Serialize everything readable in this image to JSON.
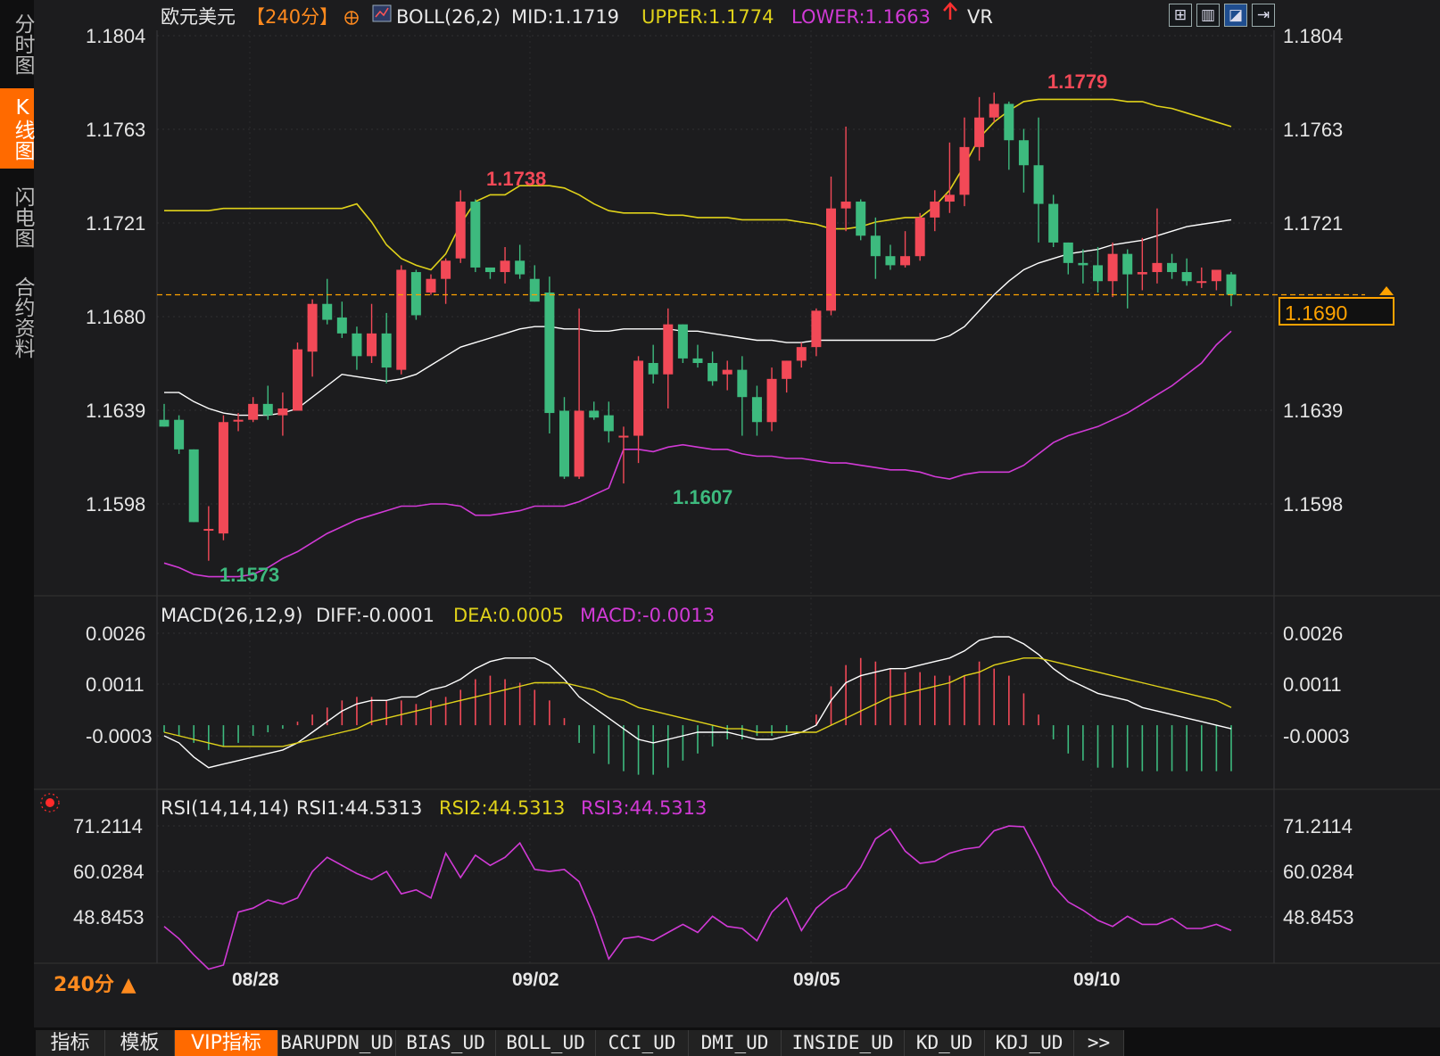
{
  "sidebar": {
    "tabs": [
      {
        "label": "分时图",
        "active": false
      },
      {
        "label": "K线图",
        "active": true
      },
      {
        "label": "闪电图",
        "active": false
      },
      {
        "label": "合约资料",
        "active": false
      }
    ]
  },
  "header": {
    "symbol": "欧元美元",
    "period": "【240分】",
    "boll": "BOLL(26,2)",
    "mid": "MID:1.1719",
    "upper": "UPPER:1.1774",
    "lower": "LOWER:1.1663",
    "extra": "VR"
  },
  "toolbar": {
    "icons": [
      "grid-icon",
      "chart-window-icon",
      "chart-trend-icon",
      "exit-window-icon"
    ]
  },
  "price_axis": {
    "ticks": [
      "1.1804",
      "1.1763",
      "1.1721",
      "1.1680",
      "1.1639",
      "1.1598"
    ]
  },
  "current_price": "1.1690",
  "annotations": {
    "high1": "1.1738",
    "high2": "1.1779",
    "low1": "1.1573",
    "low2": "1.1607"
  },
  "macd": {
    "title": "MACD(26,12,9)",
    "diff": "DIFF:-0.0001",
    "dea": "DEA:0.0005",
    "macd": "MACD:-0.0013",
    "ticks": [
      "0.0026",
      "0.0011",
      "-0.0003"
    ]
  },
  "rsi": {
    "title": "RSI(14,14,14)",
    "rsi1": "RSI1:44.5313",
    "rsi2": "RSI2:44.5313",
    "rsi3": "RSI3:44.5313",
    "ticks": [
      "71.2114",
      "60.0284",
      "48.8453"
    ]
  },
  "x_axis": {
    "labels": [
      "08/28",
      "09/02",
      "09/05",
      "09/10"
    ]
  },
  "period_label": "240分 ▲",
  "bottom_tabs": [
    {
      "label": "指标",
      "type": "cn"
    },
    {
      "label": "模板",
      "type": "cn"
    },
    {
      "label": "VIP指标",
      "type": "vip"
    },
    {
      "label": "BARUPDN_UD",
      "type": "en"
    },
    {
      "label": "BIAS_UD",
      "type": "en"
    },
    {
      "label": "BOLL_UD",
      "type": "en"
    },
    {
      "label": "CCI_UD",
      "type": "en"
    },
    {
      "label": "DMI_UD",
      "type": "en"
    },
    {
      "label": "INSIDE_UD",
      "type": "en"
    },
    {
      "label": "KD_UD",
      "type": "en"
    },
    {
      "label": "KDJ_UD",
      "type": "en"
    },
    {
      "label": ">>",
      "type": "en"
    }
  ],
  "colors": {
    "up": "#f24957",
    "down": "#3dba7e",
    "upper": "#e0d21a",
    "lower": "#d13ad6",
    "mid": "#ffffff",
    "accent": "#ff6a00"
  },
  "chart_data": {
    "type": "candlestick",
    "candles": [
      {
        "o": 1.1635,
        "h": 1.1642,
        "l": 1.1634,
        "c": 1.1632
      },
      {
        "o": 1.1635,
        "h": 1.1637,
        "l": 1.162,
        "c": 1.1622
      },
      {
        "o": 1.1622,
        "h": 1.1622,
        "l": 1.159,
        "c": 1.159
      },
      {
        "o": 1.1587,
        "h": 1.1597,
        "l": 1.1573,
        "c": 1.1587
      },
      {
        "o": 1.1585,
        "h": 1.1637,
        "l": 1.1582,
        "c": 1.1634
      },
      {
        "o": 1.1635,
        "h": 1.1638,
        "l": 1.163,
        "c": 1.1635
      },
      {
        "o": 1.1635,
        "h": 1.1645,
        "l": 1.1634,
        "c": 1.1642
      },
      {
        "o": 1.1642,
        "h": 1.165,
        "l": 1.1635,
        "c": 1.1637
      },
      {
        "o": 1.1637,
        "h": 1.1647,
        "l": 1.1628,
        "c": 1.164
      },
      {
        "o": 1.1639,
        "h": 1.1669,
        "l": 1.1639,
        "c": 1.1666
      },
      {
        "o": 1.1665,
        "h": 1.1688,
        "l": 1.1654,
        "c": 1.1686
      },
      {
        "o": 1.1686,
        "h": 1.1697,
        "l": 1.1677,
        "c": 1.1679
      },
      {
        "o": 1.168,
        "h": 1.1687,
        "l": 1.1671,
        "c": 1.1673
      },
      {
        "o": 1.1673,
        "h": 1.1676,
        "l": 1.1657,
        "c": 1.1663
      },
      {
        "o": 1.1663,
        "h": 1.1686,
        "l": 1.166,
        "c": 1.1673
      },
      {
        "o": 1.1673,
        "h": 1.1682,
        "l": 1.1651,
        "c": 1.1658
      },
      {
        "o": 1.1657,
        "h": 1.1703,
        "l": 1.1655,
        "c": 1.1701
      },
      {
        "o": 1.17,
        "h": 1.1701,
        "l": 1.1679,
        "c": 1.1681
      },
      {
        "o": 1.1691,
        "h": 1.1699,
        "l": 1.169,
        "c": 1.1697
      },
      {
        "o": 1.1697,
        "h": 1.1706,
        "l": 1.1686,
        "c": 1.1705
      },
      {
        "o": 1.1706,
        "h": 1.1736,
        "l": 1.1704,
        "c": 1.1731
      },
      {
        "o": 1.1731,
        "h": 1.1732,
        "l": 1.17,
        "c": 1.1702
      },
      {
        "o": 1.1702,
        "h": 1.17,
        "l": 1.1697,
        "c": 1.17
      },
      {
        "o": 1.17,
        "h": 1.1711,
        "l": 1.1695,
        "c": 1.1705
      },
      {
        "o": 1.1705,
        "h": 1.1712,
        "l": 1.1697,
        "c": 1.1699
      },
      {
        "o": 1.1697,
        "h": 1.1703,
        "l": 1.1688,
        "c": 1.1687
      },
      {
        "o": 1.1691,
        "h": 1.1698,
        "l": 1.1629,
        "c": 1.1638
      },
      {
        "o": 1.1639,
        "h": 1.1645,
        "l": 1.1609,
        "c": 1.161
      },
      {
        "o": 1.161,
        "h": 1.1684,
        "l": 1.1609,
        "c": 1.1639
      },
      {
        "o": 1.1639,
        "h": 1.1643,
        "l": 1.1635,
        "c": 1.1636
      },
      {
        "o": 1.1637,
        "h": 1.1643,
        "l": 1.1625,
        "c": 1.163
      },
      {
        "o": 1.1628,
        "h": 1.1632,
        "l": 1.1607,
        "c": 1.1628
      },
      {
        "o": 1.1628,
        "h": 1.1663,
        "l": 1.1616,
        "c": 1.1661
      },
      {
        "o": 1.166,
        "h": 1.1668,
        "l": 1.1651,
        "c": 1.1655
      },
      {
        "o": 1.1655,
        "h": 1.1684,
        "l": 1.164,
        "c": 1.1677
      },
      {
        "o": 1.1677,
        "h": 1.1676,
        "l": 1.166,
        "c": 1.1662
      },
      {
        "o": 1.1662,
        "h": 1.1668,
        "l": 1.1658,
        "c": 1.166
      },
      {
        "o": 1.166,
        "h": 1.1665,
        "l": 1.165,
        "c": 1.1652
      },
      {
        "o": 1.1655,
        "h": 1.1661,
        "l": 1.1648,
        "c": 1.1657
      },
      {
        "o": 1.1657,
        "h": 1.1663,
        "l": 1.1628,
        "c": 1.1645
      },
      {
        "o": 1.1645,
        "h": 1.165,
        "l": 1.1628,
        "c": 1.1634
      },
      {
        "o": 1.1634,
        "h": 1.1658,
        "l": 1.163,
        "c": 1.1653
      },
      {
        "o": 1.1653,
        "h": 1.1661,
        "l": 1.1647,
        "c": 1.1661
      },
      {
        "o": 1.1661,
        "h": 1.1669,
        "l": 1.1658,
        "c": 1.1667
      },
      {
        "o": 1.1667,
        "h": 1.1684,
        "l": 1.1663,
        "c": 1.1683
      },
      {
        "o": 1.1683,
        "h": 1.1742,
        "l": 1.1681,
        "c": 1.1728
      },
      {
        "o": 1.1728,
        "h": 1.1764,
        "l": 1.1718,
        "c": 1.1731
      },
      {
        "o": 1.1731,
        "h": 1.1732,
        "l": 1.1714,
        "c": 1.1716
      },
      {
        "o": 1.1716,
        "h": 1.1724,
        "l": 1.1697,
        "c": 1.1707
      },
      {
        "o": 1.1707,
        "h": 1.1712,
        "l": 1.1701,
        "c": 1.1703
      },
      {
        "o": 1.1703,
        "h": 1.1718,
        "l": 1.1702,
        "c": 1.1707
      },
      {
        "o": 1.1707,
        "h": 1.1726,
        "l": 1.1705,
        "c": 1.1724
      },
      {
        "o": 1.1724,
        "h": 1.1736,
        "l": 1.1718,
        "c": 1.1731
      },
      {
        "o": 1.1731,
        "h": 1.1757,
        "l": 1.1726,
        "c": 1.1734
      },
      {
        "o": 1.1734,
        "h": 1.1768,
        "l": 1.1729,
        "c": 1.1755
      },
      {
        "o": 1.1755,
        "h": 1.1777,
        "l": 1.1749,
        "c": 1.1768
      },
      {
        "o": 1.1768,
        "h": 1.1779,
        "l": 1.1766,
        "c": 1.1774
      },
      {
        "o": 1.1774,
        "h": 1.1775,
        "l": 1.1745,
        "c": 1.1758
      },
      {
        "o": 1.1758,
        "h": 1.1763,
        "l": 1.1735,
        "c": 1.1747
      },
      {
        "o": 1.1747,
        "h": 1.1768,
        "l": 1.1713,
        "c": 1.173
      },
      {
        "o": 1.173,
        "h": 1.1734,
        "l": 1.1711,
        "c": 1.1713
      },
      {
        "o": 1.1713,
        "h": 1.1712,
        "l": 1.1699,
        "c": 1.1704
      },
      {
        "o": 1.1704,
        "h": 1.171,
        "l": 1.1695,
        "c": 1.1703
      },
      {
        "o": 1.1703,
        "h": 1.1711,
        "l": 1.1691,
        "c": 1.1696
      },
      {
        "o": 1.1696,
        "h": 1.1713,
        "l": 1.1689,
        "c": 1.1708
      },
      {
        "o": 1.1708,
        "h": 1.171,
        "l": 1.1684,
        "c": 1.1699
      },
      {
        "o": 1.1699,
        "h": 1.1715,
        "l": 1.1692,
        "c": 1.17
      },
      {
        "o": 1.17,
        "h": 1.1728,
        "l": 1.1695,
        "c": 1.1704
      },
      {
        "o": 1.1704,
        "h": 1.1708,
        "l": 1.1697,
        "c": 1.17
      },
      {
        "o": 1.17,
        "h": 1.1706,
        "l": 1.1694,
        "c": 1.1696
      },
      {
        "o": 1.1696,
        "h": 1.1702,
        "l": 1.1693,
        "c": 1.1696
      },
      {
        "o": 1.1696,
        "h": 1.17,
        "l": 1.1692,
        "c": 1.1701
      },
      {
        "o": 1.1699,
        "h": 1.17,
        "l": 1.1685,
        "c": 1.169
      }
    ],
    "mid": [
      1.1647,
      1.1647,
      1.1643,
      1.164,
      1.1638,
      1.1637,
      1.1637,
      1.1637,
      1.1638,
      1.164,
      1.1645,
      1.165,
      1.1655,
      1.1654,
      1.1653,
      1.1652,
      1.1653,
      1.1655,
      1.1659,
      1.1663,
      1.1667,
      1.1669,
      1.1671,
      1.1673,
      1.1675,
      1.1676,
      1.1676,
      1.1675,
      1.1675,
      1.1674,
      1.1674,
      1.1675,
      1.1675,
      1.1675,
      1.1675,
      1.1674,
      1.1674,
      1.1673,
      1.1672,
      1.1671,
      1.167,
      1.167,
      1.1669,
      1.1669,
      1.167,
      1.167,
      1.167,
      1.167,
      1.167,
      1.167,
      1.167,
      1.167,
      1.167,
      1.1672,
      1.1676,
      1.1683,
      1.169,
      1.1696,
      1.1701,
      1.1704,
      1.1706,
      1.1708,
      1.1709,
      1.171,
      1.1712,
      1.1713,
      1.1714,
      1.1716,
      1.1718,
      1.172,
      1.1721,
      1.1722,
      1.1723
    ],
    "upper": [
      1.1727,
      1.1727,
      1.1727,
      1.1727,
      1.1728,
      1.1728,
      1.1728,
      1.1728,
      1.1728,
      1.1728,
      1.1728,
      1.1728,
      1.1728,
      1.173,
      1.1722,
      1.1712,
      1.1706,
      1.1703,
      1.1701,
      1.1708,
      1.1721,
      1.1731,
      1.1734,
      1.1734,
      1.1738,
      1.1738,
      1.1738,
      1.1737,
      1.1734,
      1.173,
      1.1727,
      1.1726,
      1.1726,
      1.1726,
      1.1725,
      1.1725,
      1.1724,
      1.1724,
      1.1724,
      1.1723,
      1.1723,
      1.1723,
      1.1723,
      1.1722,
      1.1721,
      1.1719,
      1.1719,
      1.172,
      1.1722,
      1.1723,
      1.1724,
      1.1724,
      1.1729,
      1.1736,
      1.1747,
      1.1759,
      1.1766,
      1.1771,
      1.1775,
      1.1776,
      1.1776,
      1.1776,
      1.1776,
      1.1776,
      1.1776,
      1.1775,
      1.1775,
      1.1773,
      1.1772,
      1.177,
      1.1768,
      1.1766,
      1.1764
    ],
    "lower": [
      1.1572,
      1.157,
      1.1567,
      1.1566,
      1.1566,
      1.1566,
      1.1567,
      1.157,
      1.1574,
      1.1577,
      1.1581,
      1.1585,
      1.1588,
      1.1591,
      1.1593,
      1.1595,
      1.1597,
      1.1597,
      1.1598,
      1.1598,
      1.1597,
      1.1593,
      1.1593,
      1.1594,
      1.1595,
      1.1597,
      1.1597,
      1.1597,
      1.1599,
      1.1602,
      1.1605,
      1.1622,
      1.1622,
      1.1621,
      1.1623,
      1.1624,
      1.1623,
      1.1622,
      1.1622,
      1.162,
      1.1619,
      1.1619,
      1.1618,
      1.1618,
      1.1617,
      1.1616,
      1.1616,
      1.1615,
      1.1614,
      1.1613,
      1.1613,
      1.1612,
      1.161,
      1.1609,
      1.1611,
      1.1612,
      1.1612,
      1.1612,
      1.1615,
      1.162,
      1.1625,
      1.1628,
      1.163,
      1.1632,
      1.1635,
      1.1638,
      1.1642,
      1.1646,
      1.165,
      1.1655,
      1.166,
      1.1668,
      1.1674
    ],
    "macd_diff": [
      -0.0003,
      -0.0005,
      -0.0009,
      -0.0012,
      -0.0011,
      -0.001,
      -0.0009,
      -0.0008,
      -0.0007,
      -0.0005,
      -0.0002,
      0.0001,
      0.0004,
      0.0006,
      0.0007,
      0.0007,
      0.0008,
      0.0008,
      0.001,
      0.0011,
      0.0013,
      0.0016,
      0.0018,
      0.0019,
      0.0019,
      0.0019,
      0.0017,
      0.0013,
      0.0008,
      0.0005,
      0.0002,
      -0.0001,
      -0.0004,
      -0.0005,
      -0.0004,
      -0.0003,
      -0.0002,
      -0.0002,
      -0.0002,
      -0.0003,
      -0.0004,
      -0.0004,
      -0.0003,
      -0.0002,
      0.0,
      0.0007,
      0.0012,
      0.0014,
      0.0015,
      0.0016,
      0.0016,
      0.0017,
      0.0018,
      0.0019,
      0.0021,
      0.0024,
      0.0025,
      0.0025,
      0.0023,
      0.002,
      0.0016,
      0.0013,
      0.0011,
      0.0009,
      0.0008,
      0.0007,
      0.0005,
      0.0004,
      0.0003,
      0.0002,
      0.0001,
      0.0,
      -0.0001
    ],
    "macd_dea": [
      -0.0002,
      -0.0003,
      -0.0004,
      -0.0005,
      -0.0006,
      -0.0006,
      -0.0006,
      -0.0006,
      -0.0006,
      -0.0005,
      -0.0004,
      -0.0003,
      -0.0002,
      -0.0001,
      0.0001,
      0.0002,
      0.0003,
      0.0004,
      0.0005,
      0.0006,
      0.0007,
      0.0008,
      0.0009,
      0.001,
      0.0011,
      0.0012,
      0.0012,
      0.0012,
      0.0011,
      0.001,
      0.0008,
      0.0007,
      0.0005,
      0.0004,
      0.0003,
      0.0002,
      0.0001,
      0.0,
      -0.0001,
      -0.0001,
      -0.0002,
      -0.0002,
      -0.0002,
      -0.0002,
      -0.0002,
      -0.0,
      0.0002,
      0.0004,
      0.0006,
      0.0008,
      0.0009,
      0.001,
      0.0011,
      0.0012,
      0.0014,
      0.0015,
      0.0017,
      0.0018,
      0.0019,
      0.0019,
      0.0018,
      0.0017,
      0.0016,
      0.0015,
      0.0014,
      0.0013,
      0.0012,
      0.0011,
      0.001,
      0.0009,
      0.0008,
      0.0007,
      0.0005
    ],
    "macd_hist": [
      -0.0002,
      -0.0003,
      -0.0005,
      -0.0007,
      -0.0006,
      -0.0005,
      -0.0003,
      -0.0002,
      -0.0001,
      0.0001,
      0.0003,
      0.0005,
      0.0007,
      0.0008,
      0.0008,
      0.0007,
      0.0007,
      0.0006,
      0.0007,
      0.0008,
      0.001,
      0.0013,
      0.0014,
      0.0013,
      0.0012,
      0.001,
      0.0007,
      0.0002,
      -0.0005,
      -0.0008,
      -0.0011,
      -0.0013,
      -0.0014,
      -0.0014,
      -0.0012,
      -0.001,
      -0.0008,
      -0.0006,
      -0.0004,
      -0.0004,
      -0.0003,
      -0.0003,
      -0.0002,
      0.0,
      0.0003,
      0.0011,
      0.0017,
      0.0019,
      0.0018,
      0.0016,
      0.0015,
      0.0015,
      0.0014,
      0.0014,
      0.0014,
      0.0018,
      0.0016,
      0.0014,
      0.0009,
      0.0003,
      -0.0004,
      -0.0008,
      -0.001,
      -0.0012,
      -0.0012,
      -0.0012,
      -0.0013,
      -0.0013,
      -0.0013,
      -0.0013,
      -0.0013,
      -0.0013,
      -0.0013
    ],
    "rsi": [
      46.5,
      43.5,
      39.5,
      36.0,
      37.0,
      50.0,
      51.0,
      53.0,
      52.0,
      53.5,
      60.0,
      63.5,
      61.5,
      59.5,
      58.0,
      60.0,
      54.5,
      55.5,
      53.5,
      64.5,
      58.5,
      64.0,
      61.5,
      63.5,
      67.0,
      60.5,
      60.0,
      60.5,
      57.5,
      49.0,
      38.5,
      43.5,
      44.0,
      43.0,
      45.0,
      47.0,
      45.0,
      49.0,
      46.5,
      46.0,
      43.0,
      50.0,
      53.5,
      45.5,
      51.0,
      54.0,
      56.0,
      61.0,
      68.0,
      70.5,
      65.0,
      62.0,
      62.5,
      64.5,
      65.5,
      66.0,
      70.0,
      71.2,
      71.0,
      64.0,
      56.5,
      52.5,
      50.5,
      48.0,
      46.5,
      49.0,
      47.0,
      47.0,
      48.5,
      46.0,
      46.0,
      47.0,
      45.5
    ],
    "y_ticks": [
      1.1804,
      1.1763,
      1.1721,
      1.168,
      1.1639,
      1.1598
    ]
  }
}
